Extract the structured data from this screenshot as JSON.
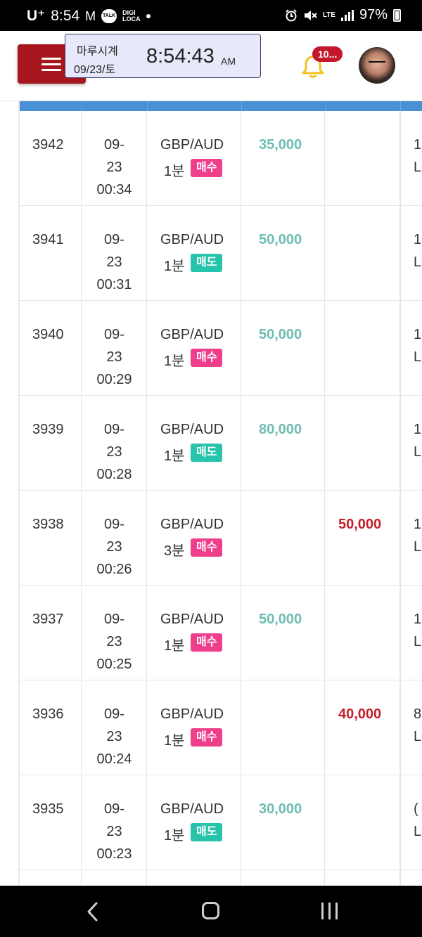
{
  "status_bar": {
    "carrier": "U⁺",
    "time": "8:54",
    "talk_label": "TALK",
    "digi_label": "DIGI\nLOCA",
    "network": "LTE",
    "battery": "97%"
  },
  "header": {
    "clock_name": "마루시계",
    "clock_date": "09/23/토",
    "clock_time": "8:54:43",
    "clock_ampm": "AM",
    "notification_count": "10..."
  },
  "rows": [
    {
      "id": "3942",
      "date": "09-",
      "day": "23",
      "time": "00:34",
      "symbol": "GBP/AUD",
      "duration": "1분",
      "side": "매수",
      "side_type": "buy",
      "buy_amount": "35,000",
      "sell_amount": "",
      "last_top": "1",
      "last_bottom": "L"
    },
    {
      "id": "3941",
      "date": "09-",
      "day": "23",
      "time": "00:31",
      "symbol": "GBP/AUD",
      "duration": "1분",
      "side": "매도",
      "side_type": "sell",
      "buy_amount": "50,000",
      "sell_amount": "",
      "last_top": "1",
      "last_bottom": "L"
    },
    {
      "id": "3940",
      "date": "09-",
      "day": "23",
      "time": "00:29",
      "symbol": "GBP/AUD",
      "duration": "1분",
      "side": "매수",
      "side_type": "buy",
      "buy_amount": "50,000",
      "sell_amount": "",
      "last_top": "1",
      "last_bottom": "L"
    },
    {
      "id": "3939",
      "date": "09-",
      "day": "23",
      "time": "00:28",
      "symbol": "GBP/AUD",
      "duration": "1분",
      "side": "매도",
      "side_type": "sell",
      "buy_amount": "80,000",
      "sell_amount": "",
      "last_top": "1",
      "last_bottom": "L"
    },
    {
      "id": "3938",
      "date": "09-",
      "day": "23",
      "time": "00:26",
      "symbol": "GBP/AUD",
      "duration": "3분",
      "side": "매수",
      "side_type": "buy",
      "buy_amount": "",
      "sell_amount": "50,000",
      "last_top": "1",
      "last_bottom": "L"
    },
    {
      "id": "3937",
      "date": "09-",
      "day": "23",
      "time": "00:25",
      "symbol": "GBP/AUD",
      "duration": "1분",
      "side": "매수",
      "side_type": "buy",
      "buy_amount": "50,000",
      "sell_amount": "",
      "last_top": "1",
      "last_bottom": "L"
    },
    {
      "id": "3936",
      "date": "09-",
      "day": "23",
      "time": "00:24",
      "symbol": "GBP/AUD",
      "duration": "1분",
      "side": "매수",
      "side_type": "buy",
      "buy_amount": "",
      "sell_amount": "40,000",
      "last_top": "8",
      "last_bottom": "L"
    },
    {
      "id": "3935",
      "date": "09-",
      "day": "23",
      "time": "00:23",
      "symbol": "GBP/AUD",
      "duration": "1분",
      "side": "매도",
      "side_type": "sell",
      "buy_amount": "30,000",
      "sell_amount": "",
      "last_top": "(",
      "last_bottom": "L"
    }
  ],
  "colors": {
    "menu_button": "#a7161c",
    "header_strip": "#4a90d6",
    "buy_badge": "#ef3f8c",
    "sell_badge": "#27c3ab",
    "buy_amount": "#6dbdb2",
    "sell_amount": "#c3202c"
  },
  "icons": {
    "menu": "hamburger-icon",
    "bell": "bell-icon",
    "back": "back-icon",
    "home": "home-icon",
    "recent": "recent-apps-icon"
  }
}
